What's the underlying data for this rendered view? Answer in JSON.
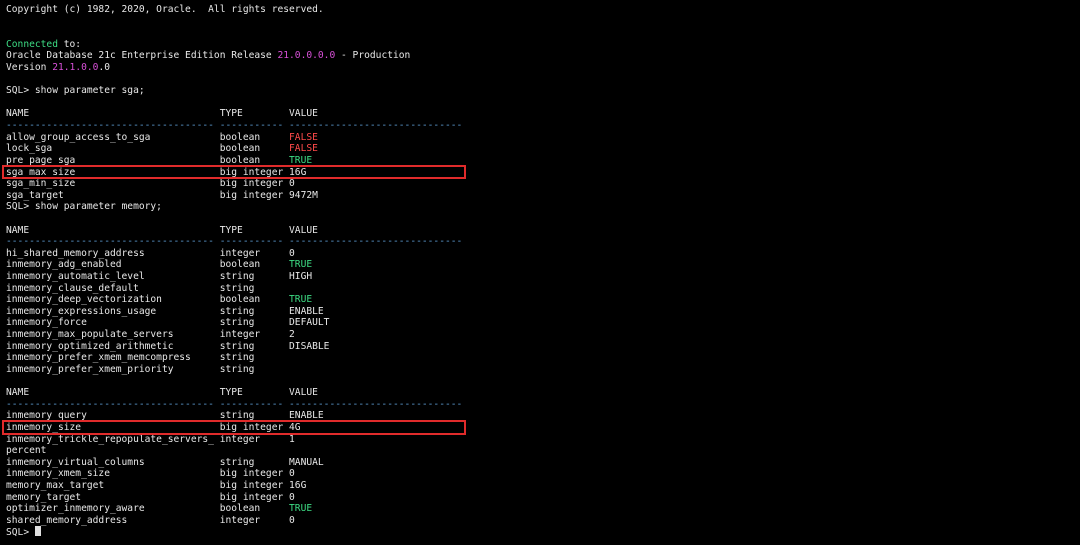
{
  "terminal": {
    "lines": [
      {
        "segments": [
          {
            "text": "Copyright (c) 1982, 2020, Oracle.  All rights reserved."
          }
        ]
      },
      {
        "segments": []
      },
      {
        "segments": []
      },
      {
        "segments": [
          {
            "text": "Connected",
            "color": "green"
          },
          {
            "text": " to:"
          }
        ]
      },
      {
        "segments": [
          {
            "text": "Oracle Database 21c Enterprise Edition Release "
          },
          {
            "text": "21.0.0.0.0",
            "color": "magenta"
          },
          {
            "text": " - Production"
          }
        ]
      },
      {
        "segments": [
          {
            "text": "Version "
          },
          {
            "text": "21.1.0.0",
            "color": "magenta"
          },
          {
            "text": ".0"
          }
        ]
      },
      {
        "segments": []
      },
      {
        "segments": [
          {
            "text": "SQL> show parameter sga;"
          }
        ]
      },
      {
        "segments": []
      },
      {
        "segments": [
          {
            "text": "NAME                                 TYPE        VALUE"
          }
        ]
      },
      {
        "segments": [
          {
            "text": "------------------------------------ ----------- ------------------------------",
            "color": "blue"
          }
        ]
      },
      {
        "segments": [
          {
            "text": "allow_group_access_to_sga            boolean     "
          },
          {
            "text": "FALSE",
            "color": "red"
          }
        ]
      },
      {
        "segments": [
          {
            "text": "lock_sga                             boolean     "
          },
          {
            "text": "FALSE",
            "color": "red"
          }
        ]
      },
      {
        "segments": [
          {
            "text": "pre_page_sga                         boolean     "
          },
          {
            "text": "TRUE",
            "color": "green"
          }
        ]
      },
      {
        "segments": [
          {
            "text": "sga_max_size                         big integer 16G"
          }
        ],
        "highlight": true
      },
      {
        "segments": [
          {
            "text": "sga_min_size                         big integer 0"
          }
        ]
      },
      {
        "segments": [
          {
            "text": "sga_target                           big integer 9472M"
          }
        ]
      },
      {
        "segments": [
          {
            "text": "SQL> show parameter memory;"
          }
        ]
      },
      {
        "segments": []
      },
      {
        "segments": [
          {
            "text": "NAME                                 TYPE        VALUE"
          }
        ]
      },
      {
        "segments": [
          {
            "text": "------------------------------------ ----------- ------------------------------",
            "color": "blue"
          }
        ]
      },
      {
        "segments": [
          {
            "text": "hi_shared_memory_address             integer     0"
          }
        ]
      },
      {
        "segments": [
          {
            "text": "inmemory_adg_enabled                 boolean     "
          },
          {
            "text": "TRUE",
            "color": "green"
          }
        ]
      },
      {
        "segments": [
          {
            "text": "inmemory_automatic_level             string      HIGH"
          }
        ]
      },
      {
        "segments": [
          {
            "text": "inmemory_clause_default              string"
          }
        ]
      },
      {
        "segments": [
          {
            "text": "inmemory_deep_vectorization          boolean     "
          },
          {
            "text": "TRUE",
            "color": "green"
          }
        ]
      },
      {
        "segments": [
          {
            "text": "inmemory_expressions_usage           string      ENABLE"
          }
        ]
      },
      {
        "segments": [
          {
            "text": "inmemory_force                       string      DEFAULT"
          }
        ]
      },
      {
        "segments": [
          {
            "text": "inmemory_max_populate_servers        integer     2"
          }
        ]
      },
      {
        "segments": [
          {
            "text": "inmemory_optimized_arithmetic        string      DISABLE"
          }
        ]
      },
      {
        "segments": [
          {
            "text": "inmemory_prefer_xmem_memcompress     string"
          }
        ]
      },
      {
        "segments": [
          {
            "text": "inmemory_prefer_xmem_priority        string"
          }
        ]
      },
      {
        "segments": []
      },
      {
        "segments": [
          {
            "text": "NAME                                 TYPE        VALUE"
          }
        ]
      },
      {
        "segments": [
          {
            "text": "------------------------------------ ----------- ------------------------------",
            "color": "blue"
          }
        ]
      },
      {
        "segments": [
          {
            "text": "inmemory_query                       string      ENABLE"
          }
        ]
      },
      {
        "segments": [
          {
            "text": "inmemory_size                        big integer 4G"
          }
        ],
        "highlight": true
      },
      {
        "segments": [
          {
            "text": "inmemory_trickle_repopulate_servers_ integer     1"
          }
        ]
      },
      {
        "segments": [
          {
            "text": "percent"
          }
        ]
      },
      {
        "segments": [
          {
            "text": "inmemory_virtual_columns             string      MANUAL"
          }
        ]
      },
      {
        "segments": [
          {
            "text": "inmemory_xmem_size                   big integer 0"
          }
        ]
      },
      {
        "segments": [
          {
            "text": "memory_max_target                    big integer 16G"
          }
        ]
      },
      {
        "segments": [
          {
            "text": "memory_target                        big integer 0"
          }
        ]
      },
      {
        "segments": [
          {
            "text": "optimizer_inmemory_aware             boolean     "
          },
          {
            "text": "TRUE",
            "color": "green"
          }
        ]
      },
      {
        "segments": [
          {
            "text": "shared_memory_address                integer     0"
          }
        ]
      },
      {
        "segments": [
          {
            "text": "SQL> "
          }
        ],
        "cursor": true
      }
    ]
  },
  "colors": {
    "background": "#000000",
    "text": "#e8e8e8",
    "green": "#3ddc84",
    "magenta": "#d850d8",
    "red": "#ff4a4a",
    "blue": "#5f9fd8",
    "highlight_border": "#e02b2b"
  }
}
